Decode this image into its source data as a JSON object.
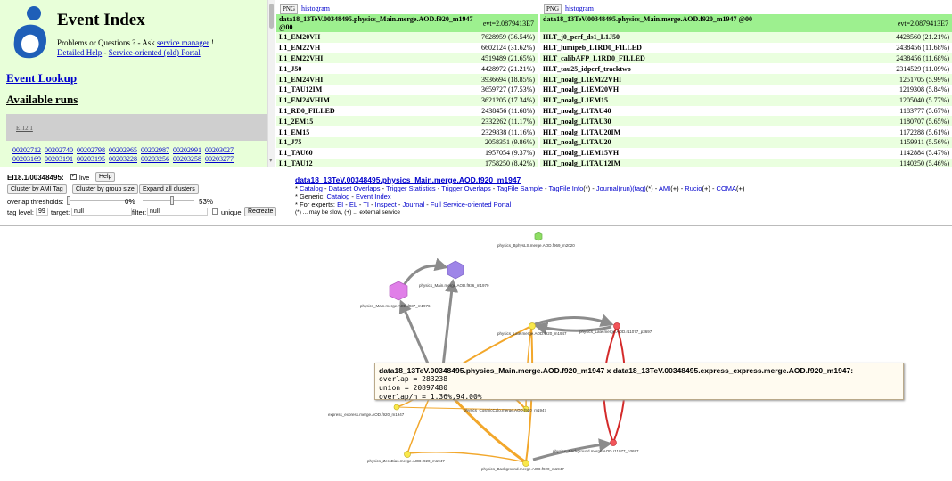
{
  "sidebar": {
    "title": "Event Index",
    "help_prefix": "Problems or Questions ? - Ask ",
    "help_link": "service manager",
    "help_suffix": " !",
    "detailed_help": "Detailed Help",
    "sep": " - ",
    "old_portal": "Service-oriented (old) Portal",
    "event_lookup": "Event Lookup",
    "available_runs": "Available runs",
    "ei_label": "EI12.1",
    "runs": [
      "00202712",
      "00202740",
      "00202798",
      "00202965",
      "00202987",
      "00202991",
      "00203027",
      "00203169",
      "00203191",
      "00203195",
      "00203228",
      "00203256",
      "00203258",
      "00203277"
    ]
  },
  "trigger_left": {
    "png": "PNG",
    "histogram": "histogram",
    "dataset": "data18_13TeV.00348495.physics_Main.merge.AOD.f920_m1947 @00",
    "evt": "evt=2.0879413E7",
    "rows": [
      {
        "name": "L1_EM20VH",
        "value": "7628959 (36.54%)"
      },
      {
        "name": "L1_EM22VH",
        "value": "6602124 (31.62%)"
      },
      {
        "name": "L1_EM22VHI",
        "value": "4519489 (21.65%)"
      },
      {
        "name": "L1_J50",
        "value": "4428972 (21.21%)"
      },
      {
        "name": "L1_EM24VHI",
        "value": "3936694 (18.85%)"
      },
      {
        "name": "L1_TAU12IM",
        "value": "3659727 (17.53%)"
      },
      {
        "name": "L1_EM24VHIM",
        "value": "3621205 (17.34%)"
      },
      {
        "name": "L1_RD0_FILLED",
        "value": "2438456 (11.68%)"
      },
      {
        "name": "L1_2EM15",
        "value": "2332262 (11.17%)"
      },
      {
        "name": "L1_EM15",
        "value": "2329838 (11.16%)"
      },
      {
        "name": "L1_J75",
        "value": "2058351 (9.86%)"
      },
      {
        "name": "L1_TAU60",
        "value": "1957054 (9.37%)"
      },
      {
        "name": "L1_TAU12",
        "value": "1758250 (8.42%)"
      }
    ]
  },
  "trigger_right": {
    "png": "PNG",
    "histogram": "histogram",
    "dataset": "data18_13TeV.00348495.physics_Main.merge.AOD.f920_m1947 @00",
    "evt": "evt=2.0879413E7",
    "rows": [
      {
        "name": "HLT_j0_perf_ds1_L1J50",
        "value": "4428560 (21.21%)"
      },
      {
        "name": "HLT_lumipeb_L1RD0_FILLED",
        "value": "2438456 (11.68%)"
      },
      {
        "name": "HLT_calibAFP_L1RD0_FILLED",
        "value": "2438456 (11.68%)"
      },
      {
        "name": "HLT_tau25_idperf_tracktwo",
        "value": "2314529 (11.09%)"
      },
      {
        "name": "HLT_noalg_L1EM22VHI",
        "value": "1251705 (5.99%)"
      },
      {
        "name": "HLT_noalg_L1EM20VH",
        "value": "1219308 (5.84%)"
      },
      {
        "name": "HLT_noalg_L1EM15",
        "value": "1205040 (5.77%)"
      },
      {
        "name": "HLT_noalg_L1TAU40",
        "value": "1183777 (5.67%)"
      },
      {
        "name": "HLT_noalg_L1TAU30",
        "value": "1180707 (5.65%)"
      },
      {
        "name": "HLT_noalg_L1TAU20IM",
        "value": "1172288 (5.61%)"
      },
      {
        "name": "HLT_noalg_L1TAU20",
        "value": "1159911 (5.56%)"
      },
      {
        "name": "HLT_noalg_L1EM15VH",
        "value": "1142884 (5.47%)"
      },
      {
        "name": "HLT_noalg_L1TAU12IM",
        "value": "1140250 (5.46%)"
      }
    ]
  },
  "controls": {
    "title": "EI18.1/00348495:",
    "live_label": "live",
    "live_checked": "✓",
    "help": "Help",
    "cluster_ami": "Cluster by AMI Tag",
    "cluster_group": "Cluster by group size",
    "expand": "Expand all clusters",
    "overlap_label": "overlap thresholds:",
    "threshold_low": "0%",
    "threshold_high": "53%",
    "threshold_low_value": 0,
    "threshold_high_value": 53,
    "tag_level_label": "tag level:",
    "tag_level": "99",
    "target_label": "target:",
    "target_value": "null",
    "filter_label": "filter:",
    "filter_value": "null",
    "unique_label": "unique",
    "recreate": "Recreate"
  },
  "info": {
    "title": "data18_13TeV.00348495.physics_Main.merge.AOD.f920_m1947",
    "bullet": "* ",
    "sep": " - ",
    "catalog": "Catalog",
    "dataset_overlaps": "Dataset Overlaps",
    "trigger_statistics": "Trigger Statistics",
    "trigger_overlaps": "Trigger Overlaps",
    "tagfile_sample": "TagFile Sample",
    "tagfile_info": "TagFile Info",
    "journal_run_tag": "Journal(run)(tag)",
    "ami": "AMI",
    "rucio": "Rucio",
    "coma": "COMA",
    "mark_slow": "(*)",
    "mark_ext": "(+)",
    "generic_label": "* Generic: ",
    "event_index": "Event Index",
    "experts_label": "* For experts: ",
    "ei": "EI",
    "el": "EL",
    "ti": "TI",
    "inspect": "Inspect",
    "journal": "Journal",
    "full_portal": "Full Service-oriented Portal",
    "note": "(*) ... may be slow, (+) ... external service"
  },
  "graph": {
    "nodes": [
      {
        "id": "bphys",
        "label": "physics_BphysLS.merge.AOD.f969_m2020"
      },
      {
        "id": "main1979",
        "label": "physics_Main.merge.AOD.f936_m1979"
      },
      {
        "id": "main1976",
        "label": "physics_Main.merge.AOD.f937_m1976"
      },
      {
        "id": "late",
        "label": "physics_Late.merge.AOD.f920_m1947"
      },
      {
        "id": "lateR",
        "label": "physics_Late.merge.AOD.r11077_p3697"
      },
      {
        "id": "express",
        "label": "express_express.merge.AOD.f920_m1947"
      },
      {
        "id": "cosmic",
        "label": "physics_CosmicCalo.merge.AOD.f920_m1947"
      },
      {
        "id": "zerobias",
        "label": "physics_ZeroBias.merge.AOD.f920_m1947"
      },
      {
        "id": "background",
        "label": "physics_Background.merge.AOD.f920_m1947"
      },
      {
        "id": "backgroundR",
        "label": "physics_Background.merge.AOD.r11077_p3697"
      }
    ],
    "tooltip": {
      "title": "data18_13TeV.00348495.physics_Main.merge.AOD.f920_m1947 x data18_13TeV.00348495.express_express.merge.AOD.f920_m1947:",
      "overlap": "overlap = 283238",
      "union": "union = 20897480",
      "ratio": "overlap/n = 1.36%,94.00%"
    }
  },
  "colors": {
    "sidebar_bg": "#e8ffd9",
    "table_header": "#9df08f",
    "row_alt": "#eaffdf",
    "link": "#0000cc",
    "edge_gray": "#8c8c8c",
    "edge_orange": "#f2a72b",
    "edge_red": "#d42a2a",
    "node_purple": "#9e85e8",
    "node_pink": "#e07fe8",
    "node_yellow": "#f9e84a",
    "node_red": "#f2555a",
    "node_green": "#8ede63"
  },
  "icons": [
    "event-index-logo",
    "checkbox-check-icon",
    "scroll-down-icon"
  ]
}
